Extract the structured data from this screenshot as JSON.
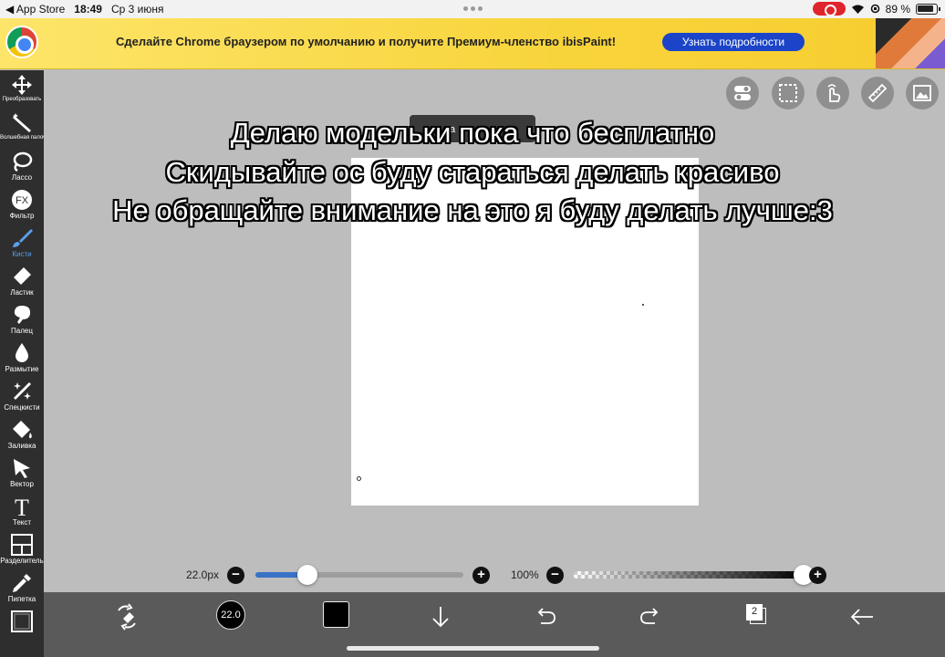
{
  "status": {
    "back_app": "◀ App Store",
    "time": "18:49",
    "date": "Ср 3 июня",
    "battery": "89 %"
  },
  "banner": {
    "text": "Сделайте Chrome браузером по умолчанию и получите Премиум-членство ibisPaint!",
    "button": "Узнать подробности"
  },
  "tools": [
    {
      "name": "transform",
      "label": "Преобразовать"
    },
    {
      "name": "magic-wand",
      "label": "Волшебная палочка"
    },
    {
      "name": "lasso",
      "label": "Лассо"
    },
    {
      "name": "filter",
      "label": "Фильтр"
    },
    {
      "name": "brush",
      "label": "Кисти"
    },
    {
      "name": "eraser",
      "label": "Ластик"
    },
    {
      "name": "finger",
      "label": "Палец"
    },
    {
      "name": "blur",
      "label": "Размытие"
    },
    {
      "name": "special-brush",
      "label": "Спецкисти"
    },
    {
      "name": "fill",
      "label": "Заливка"
    },
    {
      "name": "vector",
      "label": "Вектор"
    },
    {
      "name": "text",
      "label": "Текст"
    },
    {
      "name": "divider",
      "label": "Разделитель"
    },
    {
      "name": "eyedropper",
      "label": "Пипетка"
    }
  ],
  "tooltip": "а",
  "captions": [
    "Делаю модельки пока что бесплатно",
    "Скидывайте ос буду стараться делать красиво",
    "Не обращайте внимание на это я буду делать лучше:3"
  ],
  "brush": {
    "size_label": "22.0px",
    "size_value": "22.0",
    "size_fraction": 0.25,
    "opacity_label": "100%",
    "opacity_fraction": 1.0
  },
  "layers": {
    "count": "2"
  },
  "colors": {
    "accent": "#3a72c6",
    "banner_button": "#1b44c8",
    "toolbar": "#2e2e2e"
  }
}
